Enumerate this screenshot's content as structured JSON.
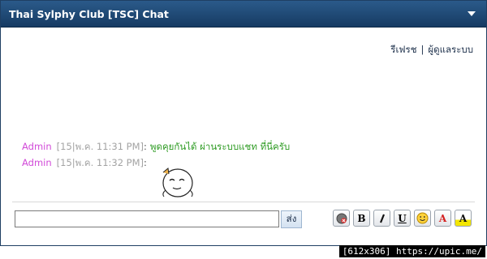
{
  "header": {
    "title": "Thai Sylphy Club [TSC] Chat",
    "collapse_icon": "collapse-arrow-icon"
  },
  "top_links": {
    "refresh": "รีเฟรช",
    "separator": "|",
    "admin": "ผู้ดูแลระบบ"
  },
  "messages": [
    {
      "user": "Admin",
      "time": "[15|พ.ค. 11:31 PM]",
      "colon": ":",
      "text": "พูดคุยกันได้ ผ่านระบบแชท ที่นี่ครับ"
    },
    {
      "user": "Admin",
      "time": "[15|พ.ค. 11:32 PM]",
      "colon": ":",
      "text": "",
      "emoticon": "sleepy-face-emoticon"
    }
  ],
  "input": {
    "value": "",
    "placeholder": ""
  },
  "send_label": "ส่ง",
  "toolbar": {
    "clear": {
      "icon": "clear-icon"
    },
    "bold": {
      "label": "B"
    },
    "italic": {
      "icon": "italic-icon"
    },
    "underline": {
      "label": "U"
    },
    "smiley": {
      "icon": "smiley-icon"
    },
    "color": {
      "label": "A"
    },
    "highlight": {
      "label": "A"
    }
  },
  "footer": "[612x306] https://upic.me/",
  "colors": {
    "title_bar": "#1f4a76",
    "username": "#d14ad8",
    "timestamp": "#a3a3a3",
    "message_text": "#2e9b23"
  }
}
